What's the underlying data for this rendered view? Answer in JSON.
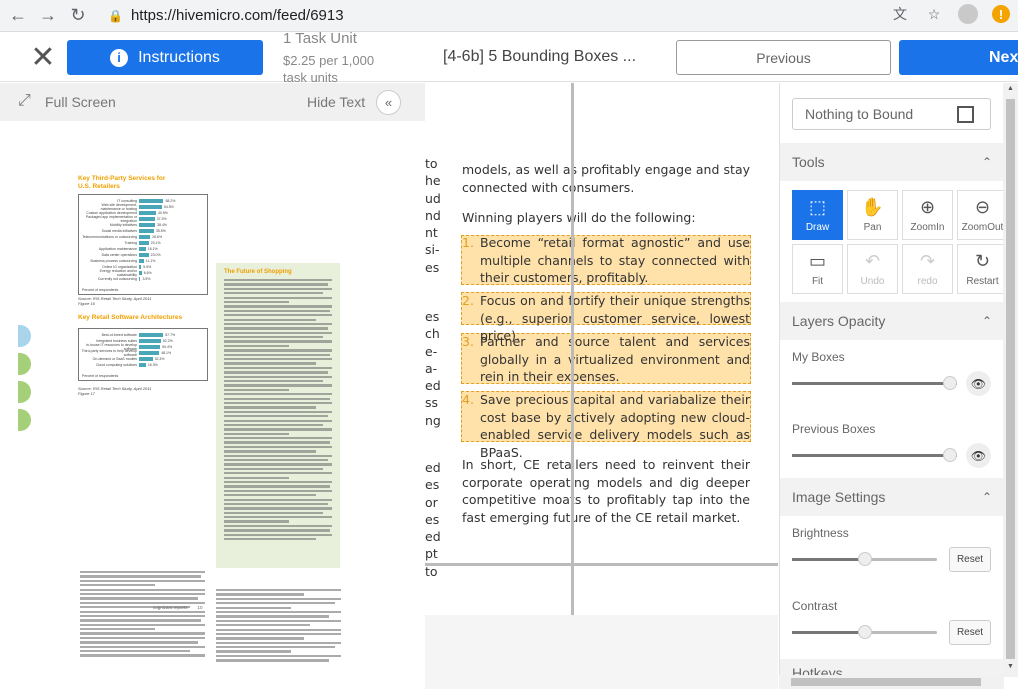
{
  "browser": {
    "url": "https://hivemicro.com/feed/6913"
  },
  "header": {
    "instructions_label": "Instructions",
    "task_unit": "1 Task Unit",
    "task_price": "$2.25 per 1,000 task units",
    "task_title": "[4-6b] 5 Bounding Boxes ...",
    "previous_label": "Previous",
    "next_label": "Next"
  },
  "left_panel": {
    "full_screen_label": "Full Screen",
    "hide_text_label": "Hide Text",
    "page": {
      "chart1_title": "Key Third-Party Services for U.S. Retailers",
      "chart1_rows": [
        {
          "label": "IT consulting",
          "value": "58.2%",
          "pct": 58.2
        },
        {
          "label": "Web site development, maintenance or hosting",
          "value": "54.5%",
          "pct": 54.5
        },
        {
          "label": "Custom application development",
          "value": "40.5%",
          "pct": 40.5
        },
        {
          "label": "Packaged app implementation or integration",
          "value": "37.3%",
          "pct": 37.3
        },
        {
          "label": "Mobility initiatives",
          "value": "38.4%",
          "pct": 38.4
        },
        {
          "label": "Social media initiatives",
          "value": "35.5%",
          "pct": 35.5
        },
        {
          "label": "Telecommunications or outsourcing",
          "value": "26.6%",
          "pct": 26.6
        },
        {
          "label": "Training",
          "value": "23.1%",
          "pct": 23.1
        },
        {
          "label": "Application maintenance",
          "value": "16.1%",
          "pct": 16.1
        },
        {
          "label": "Data center operations",
          "value": "23.0%",
          "pct": 23.0
        },
        {
          "label": "Business process outsourcing",
          "value": "11.1%",
          "pct": 11.1
        },
        {
          "label": "Online IG organization",
          "value": "5.5%",
          "pct": 5.5
        },
        {
          "label": "Energy reduction and/or sustainability",
          "value": "6.6%",
          "pct": 6.6
        },
        {
          "label": "Currently not outsourcing",
          "value": "3.5%",
          "pct": 3.5
        }
      ],
      "chart1_axis": "Percent of respondents",
      "chart1_source": "Source: RIS Retail Tech Study, April 2011",
      "chart1_figure": "Figure 16",
      "chart2_title": "Key Retail Software Architectures",
      "chart2_rows": [
        {
          "label": "Best-of-breed software",
          "value": "57.7%",
          "pct": 57.7
        },
        {
          "label": "Integrated business suites",
          "value": "52.2%",
          "pct": 52.2
        },
        {
          "label": "In-house IT resources to develop software",
          "value": "50.4%",
          "pct": 50.4
        },
        {
          "label": "Third-party services to help develop software",
          "value": "48.1%",
          "pct": 48.1
        },
        {
          "label": "On-demand or SaaS models",
          "value": "32.3%",
          "pct": 32.3
        },
        {
          "label": "Cloud computing solutions",
          "value": "16.3%",
          "pct": 16.3
        }
      ],
      "chart2_axis": "Percent of respondents",
      "chart2_source": "Source: RIS Retail Tech Study, April 2011",
      "chart2_figure": "Figure 17",
      "sidebar_title": "The Future of Shopping",
      "footer_left": "cognizant reports",
      "footer_page": "10"
    }
  },
  "document": {
    "intro": "models, as well as profitably engage and stay connected with consumers.",
    "lead": "Winning players will do the following:",
    "items": [
      {
        "num": "1.",
        "text": "Become “retail format agnostic” and use multiple channels to stay connected with their customers, profitably."
      },
      {
        "num": "2.",
        "text": "Focus on and fortify their unique strengths (e.g., superior customer service, lowest price)."
      },
      {
        "num": "3.",
        "text": "Partner and source talent and services globally in a virtualized environment and rein in their expenses."
      },
      {
        "num": "4.",
        "text": "Save precious capital and variabalize their cost base by actively adopting new cloud-enabled service delivery models such as BPaaS."
      }
    ],
    "closing": "In short, CE retailers need to reinvent their corporate operating models and dig deeper competitive moats to profitably tap into the fast emerging future of the CE retail market.",
    "cut_left_top": [
      "to",
      "he",
      "ud",
      "nd",
      "nt",
      "si-",
      "es"
    ],
    "cut_left_mid": [
      "es",
      "ch",
      "e-",
      "a-",
      "ed",
      "ss",
      "ng"
    ],
    "cut_left_bot": [
      "ed",
      "es",
      "or",
      "es",
      "ed",
      "pt",
      "to"
    ]
  },
  "right_panel": {
    "nothing_to_bound_label": "Nothing to Bound",
    "tools_title": "Tools",
    "tools": [
      {
        "label": "Draw",
        "icon": "draw-box-icon",
        "glyph": "⬚",
        "state": "active"
      },
      {
        "label": "Pan",
        "icon": "hand-icon",
        "glyph": "✋",
        "state": "normal"
      },
      {
        "label": "ZoomIn",
        "icon": "zoom-in-icon",
        "glyph": "⊕",
        "state": "normal"
      },
      {
        "label": "ZoomOut",
        "icon": "zoom-out-icon",
        "glyph": "⊖",
        "state": "normal"
      },
      {
        "label": "Fit",
        "icon": "fit-icon",
        "glyph": "▭",
        "state": "normal"
      },
      {
        "label": "Undo",
        "icon": "undo-icon",
        "glyph": "↶",
        "state": "disabled"
      },
      {
        "label": "redo",
        "icon": "redo-icon",
        "glyph": "↷",
        "state": "disabled"
      },
      {
        "label": "Restart",
        "icon": "restart-icon",
        "glyph": "↻",
        "state": "normal"
      }
    ],
    "layers_title": "Layers Opacity",
    "my_boxes_label": "My Boxes",
    "my_boxes_level": 1.0,
    "previous_boxes_label": "Previous Boxes",
    "previous_boxes_level": 1.0,
    "image_settings_title": "Image Settings",
    "brightness_label": "Brightness",
    "brightness_level": 0.5,
    "contrast_label": "Contrast",
    "contrast_level": 0.5,
    "reset_label": "Reset",
    "hotkeys_title": "Hotkeys"
  },
  "colors": {
    "accent": "#1a73e8",
    "bbox_fill": "#ffc864",
    "bbox_border": "#e0a020",
    "chart_bar": "#4aa7b8",
    "heading_orange": "#f0a000",
    "sidebar_green": "#e8f0dc",
    "dot_blue": "#a8d4ec",
    "dot_green": "#a6cf7a"
  }
}
